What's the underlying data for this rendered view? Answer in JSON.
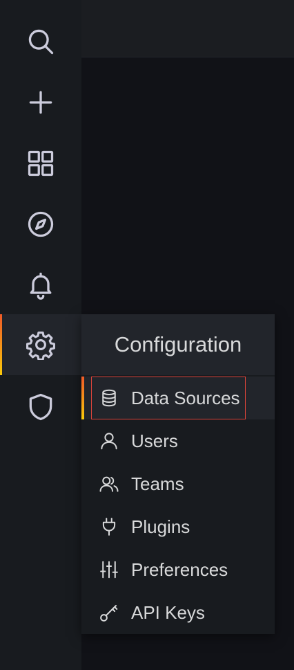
{
  "sidebar": {
    "items": [
      {
        "icon": "search-icon",
        "active": false
      },
      {
        "icon": "plus-icon",
        "active": false
      },
      {
        "icon": "dashboards-grid-icon",
        "active": false
      },
      {
        "icon": "compass-icon",
        "active": false
      },
      {
        "icon": "bell-icon",
        "active": false
      },
      {
        "icon": "gear-icon",
        "active": true
      },
      {
        "icon": "shield-icon",
        "active": false
      }
    ]
  },
  "flyout": {
    "title": "Configuration",
    "items": [
      {
        "label": "Data Sources",
        "icon": "database-icon",
        "active": true
      },
      {
        "label": "Users",
        "icon": "user-icon",
        "active": false
      },
      {
        "label": "Teams",
        "icon": "users-icon",
        "active": false
      },
      {
        "label": "Plugins",
        "icon": "plug-icon",
        "active": false
      },
      {
        "label": "Preferences",
        "icon": "sliders-icon",
        "active": false
      },
      {
        "label": "API Keys",
        "icon": "key-icon",
        "active": false
      }
    ]
  },
  "colors": {
    "sidebar_bg": "#181b1f",
    "page_bg": "#111217",
    "text": "#d8d9da",
    "icon": "#ccccdc",
    "accent_start": "#f05a28",
    "accent_end": "#fbca0a",
    "highlight_border": "#e0453b"
  }
}
